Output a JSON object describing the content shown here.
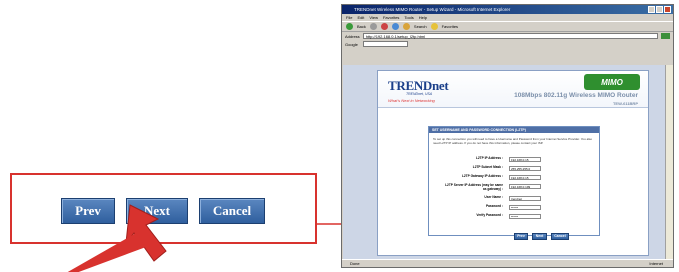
{
  "callout": {
    "buttons": {
      "prev": "Prev",
      "next": "Next",
      "cancel": "Cancel"
    }
  },
  "browser": {
    "title": "TRENDnet Wireless MIMO Router - Setup Wizard - Microsoft Internet Explorer",
    "menu": [
      "File",
      "Edit",
      "View",
      "Favorites",
      "Tools",
      "Help"
    ],
    "toolbar": {
      "back": "Back",
      "search": "Search",
      "favorites": "Favorites"
    },
    "address": {
      "label": "Address",
      "value": "http://192.168.0.1/setup_l2tp.html",
      "go": "Go"
    },
    "google_label": "Google",
    "status": {
      "left": "Done",
      "zone": "Internet"
    }
  },
  "router_page": {
    "logo": "TRENDnet",
    "logo_sub": "TRENDnet, USA",
    "tagline": "What's Next in Networking",
    "badge": "MIMO",
    "product": "108Mbps 802.11g Wireless MIMO Router",
    "model": "TEW-611BRP",
    "panel_title": "SET USERNAME AND PASSWORD CONNECTION (L2TP)",
    "panel_desc": "To set up this connection you will need to have a Username and Password from your Internet Service Provider. You also need L2TP IP address. If you do not have this information, please contact your ISP.",
    "fields": [
      {
        "label": "L2TP IP Address :",
        "value": "192.168.0.15"
      },
      {
        "label": "L2TP Subnet Mask :",
        "value": "255.255.255.0"
      },
      {
        "label": "L2TP Gateway IP Address :",
        "value": "192.168.0.15"
      },
      {
        "label": "L2TP Server IP Address (may be same as gateway) :",
        "value": "192.168.0.199"
      },
      {
        "label": "User Name :",
        "value": "trendnet"
      },
      {
        "label": "Password :",
        "value": "******"
      },
      {
        "label": "Verify Password :",
        "value": "******"
      }
    ],
    "buttons": {
      "prev": "Prev",
      "next": "Next",
      "cancel": "Cancel"
    }
  },
  "colors": {
    "accent_red": "#d8322e",
    "button_blue": "#3d6aa8"
  }
}
